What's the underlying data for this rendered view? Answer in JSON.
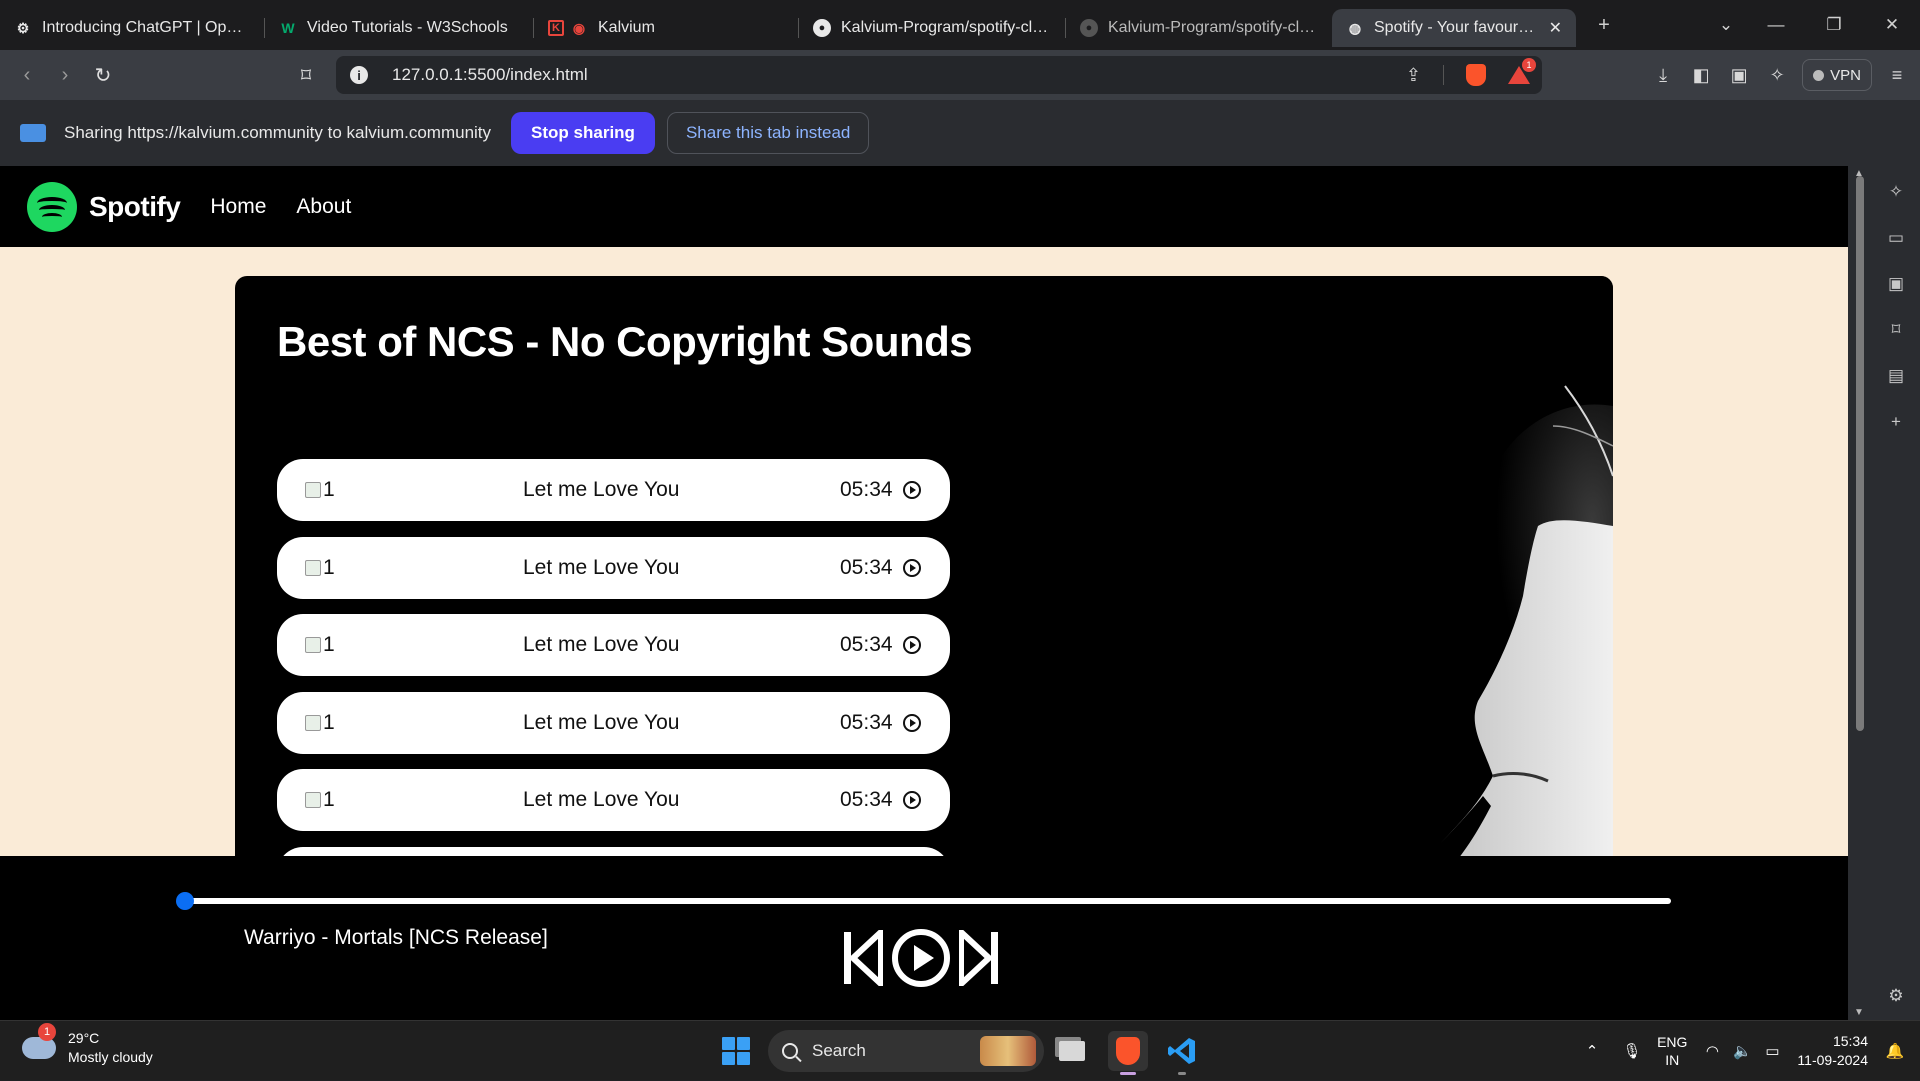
{
  "browser": {
    "tabs": [
      {
        "title": "Introducing ChatGPT | OpenAI",
        "icon": "openai-icon"
      },
      {
        "title": "Video Tutorials - W3Schools",
        "icon": "w3schools-icon"
      },
      {
        "title": "Kalvium",
        "icon": "kalvium-icon"
      },
      {
        "title": "Kalvium-Program/spotify-clone",
        "icon": "github-icon"
      },
      {
        "title": "Kalvium-Program/spotify-clone",
        "icon": "github-icon"
      },
      {
        "title": "Spotify - Your favourite music",
        "icon": "globe-icon"
      }
    ],
    "url": "127.0.0.1:5500/index.html",
    "notification_count": "1",
    "vpn_label": "VPN"
  },
  "sharebar": {
    "text": "Sharing https://kalvium.community to kalvium.community",
    "stop_label": "Stop sharing",
    "share_tab_label": "Share this tab instead"
  },
  "site": {
    "brand": "Spotify",
    "nav": {
      "home": "Home",
      "about": "About"
    },
    "playlist_title": "Best of NCS - No Copyright Sounds",
    "songs": [
      {
        "img_alt": "1",
        "name": "Let me Love You",
        "duration": "05:34"
      },
      {
        "img_alt": "1",
        "name": "Let me Love You",
        "duration": "05:34"
      },
      {
        "img_alt": "1",
        "name": "Let me Love You",
        "duration": "05:34"
      },
      {
        "img_alt": "1",
        "name": "Let me Love You",
        "duration": "05:34"
      },
      {
        "img_alt": "1",
        "name": "Let me Love You",
        "duration": "05:34"
      }
    ],
    "player": {
      "now_playing": "Warriyo - Mortals [NCS Release]",
      "progress_fraction": 0.0
    }
  },
  "colors": {
    "page_bg": "#faebd7",
    "spotify_green": "#1ed760",
    "progress_blue": "#0b6ef3",
    "stop_button": "#4a3df2"
  },
  "taskbar": {
    "weather_temp": "29°C",
    "weather_desc": "Mostly cloudy",
    "weather_badge": "1",
    "search_label": "Search",
    "lang_line1": "ENG",
    "lang_line2": "IN",
    "time": "15:34",
    "date": "11-09-2024"
  }
}
